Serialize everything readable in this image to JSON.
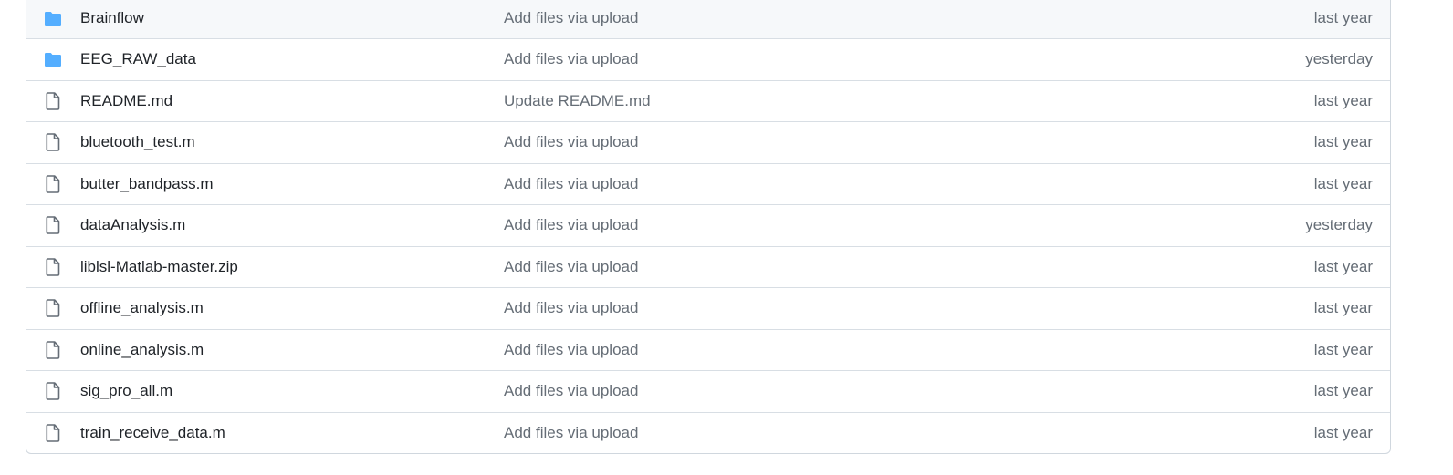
{
  "colors": {
    "folder_icon": "#54aeff",
    "file_icon": "#656d76",
    "border": "#d0d7de"
  },
  "files": [
    {
      "icon": "folder-icon",
      "name": "Brainflow",
      "message": "Add files via upload",
      "age": "last year"
    },
    {
      "icon": "folder-icon",
      "name": "EEG_RAW_data",
      "message": "Add files via upload",
      "age": "yesterday"
    },
    {
      "icon": "file-icon",
      "name": "README.md",
      "message": "Update README.md",
      "age": "last year"
    },
    {
      "icon": "file-icon",
      "name": "bluetooth_test.m",
      "message": "Add files via upload",
      "age": "last year"
    },
    {
      "icon": "file-icon",
      "name": "butter_bandpass.m",
      "message": "Add files via upload",
      "age": "last year"
    },
    {
      "icon": "file-icon",
      "name": "dataAnalysis.m",
      "message": "Add files via upload",
      "age": "yesterday"
    },
    {
      "icon": "file-icon",
      "name": "liblsl-Matlab-master.zip",
      "message": "Add files via upload",
      "age": "last year"
    },
    {
      "icon": "file-icon",
      "name": "offline_analysis.m",
      "message": "Add files via upload",
      "age": "last year"
    },
    {
      "icon": "file-icon",
      "name": "online_analysis.m",
      "message": "Add files via upload",
      "age": "last year"
    },
    {
      "icon": "file-icon",
      "name": "sig_pro_all.m",
      "message": "Add files via upload",
      "age": "last year"
    },
    {
      "icon": "file-icon",
      "name": "train_receive_data.m",
      "message": "Add files via upload",
      "age": "last year"
    }
  ]
}
